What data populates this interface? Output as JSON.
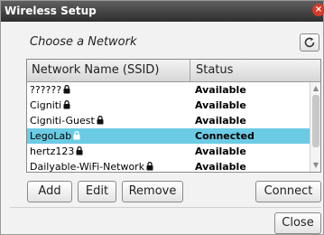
{
  "window": {
    "title": "Wireless Setup",
    "close_glyph": "×"
  },
  "header": {
    "label": "Choose a Network",
    "refresh_icon": "refresh-icon"
  },
  "table": {
    "columns": [
      "Network Name (SSID)",
      "Status"
    ],
    "rows": [
      {
        "name": "?????? ",
        "status": "Available",
        "locked": true,
        "selected": false
      },
      {
        "name": "Cigniti ",
        "status": "Available",
        "locked": true,
        "selected": false
      },
      {
        "name": "Cigniti-Guest ",
        "status": "Available",
        "locked": true,
        "selected": false
      },
      {
        "name": "LegoLab ",
        "status": "Connected",
        "locked": true,
        "selected": true
      },
      {
        "name": "hertz123 ",
        "status": "Available",
        "locked": true,
        "selected": false
      },
      {
        "name": "Dailyable-WiFi-Network ",
        "status": "Available",
        "locked": true,
        "selected": false
      }
    ],
    "selection_color": "#6ccbe4"
  },
  "buttons": {
    "add": "Add",
    "edit": "Edit",
    "remove": "Remove",
    "connect": "Connect",
    "close": "Close"
  }
}
